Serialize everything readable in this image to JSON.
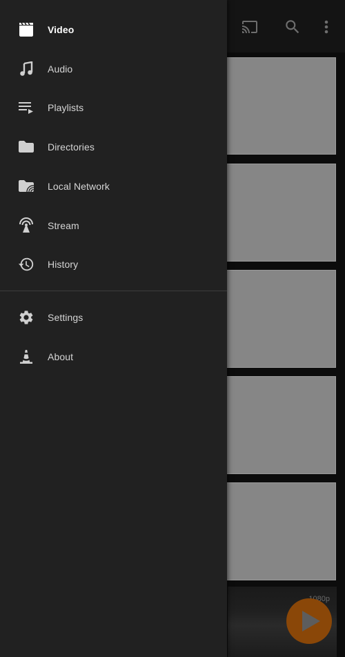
{
  "app": {
    "toolbar": {
      "cast_icon": "cast-icon",
      "search_icon": "search-icon",
      "more_icon": "more-vert-icon"
    },
    "video_list": {
      "thumbnail_count": 5,
      "last_card_badge": "1080p"
    },
    "fab": {
      "icon": "play-icon",
      "color": "#8a4708"
    }
  },
  "drawer": {
    "primary_items": [
      {
        "label": "Video",
        "icon": "movie-clapper-icon",
        "selected": true
      },
      {
        "label": "Audio",
        "icon": "music-note-icon",
        "selected": false
      },
      {
        "label": "Playlists",
        "icon": "playlist-play-icon",
        "selected": false
      },
      {
        "label": "Directories",
        "icon": "folder-icon",
        "selected": false
      },
      {
        "label": "Local Network",
        "icon": "network-folder-icon",
        "selected": false
      },
      {
        "label": "Stream",
        "icon": "stream-antenna-icon",
        "selected": false
      },
      {
        "label": "History",
        "icon": "history-icon",
        "selected": false
      }
    ],
    "secondary_items": [
      {
        "label": "Settings",
        "icon": "gear-icon",
        "selected": false
      },
      {
        "label": "About",
        "icon": "vlc-cone-icon",
        "selected": false
      }
    ]
  },
  "colors": {
    "drawer_bg": "#212121",
    "selected_text": "#ffffff",
    "item_text": "#d6d6d6",
    "icon": "#d0d0d0",
    "accent": "#8a4708"
  }
}
